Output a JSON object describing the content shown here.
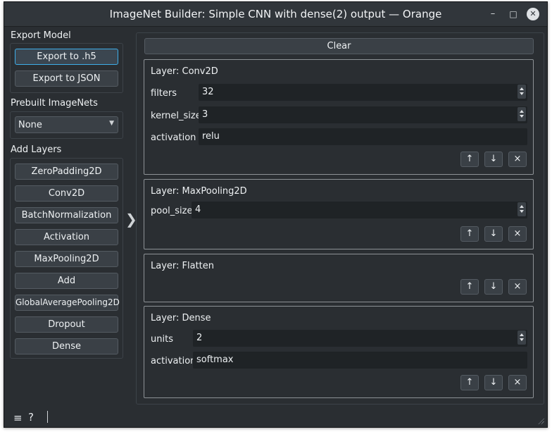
{
  "window": {
    "title": "ImageNet Builder: Simple CNN with dense(2) output — Orange"
  },
  "sidebar": {
    "export_title": "Export Model",
    "export_buttons": [
      "Export to .h5",
      "Export to JSON"
    ],
    "prebuilt_title": "Prebuilt ImageNets",
    "prebuilt_selected": "None",
    "add_title": "Add Layers",
    "add_buttons": [
      "ZeroPadding2D",
      "Conv2D",
      "BatchNormalization",
      "Activation",
      "MaxPooling2D",
      "Add",
      "GlobalAveragePooling2D",
      "Dropout",
      "Dense"
    ]
  },
  "main": {
    "clear_label": "Clear",
    "layers": [
      {
        "title": "Layer: Conv2D",
        "props": [
          {
            "label": "filters",
            "value": "32"
          },
          {
            "label": "kernel_size",
            "value": "3"
          },
          {
            "label": "activation",
            "value": "relu"
          }
        ]
      },
      {
        "title": "Layer: MaxPooling2D",
        "props": [
          {
            "label": "pool_size",
            "value": "4"
          }
        ]
      },
      {
        "title": "Layer: Flatten",
        "props": []
      },
      {
        "title": "Layer: Dense",
        "props": [
          {
            "label": "units",
            "value": "2"
          },
          {
            "label": "activation",
            "value": "softmax"
          }
        ]
      }
    ],
    "move_up_symbol": "↑",
    "move_down_symbol": "↓",
    "remove_symbol": "×"
  },
  "status": {
    "menu_icon": "≡",
    "help_icon": "?"
  },
  "colors": {
    "background": "#2a2e32",
    "accent": "#3daee9",
    "field": "#1f2326",
    "button": "#3a4046"
  }
}
